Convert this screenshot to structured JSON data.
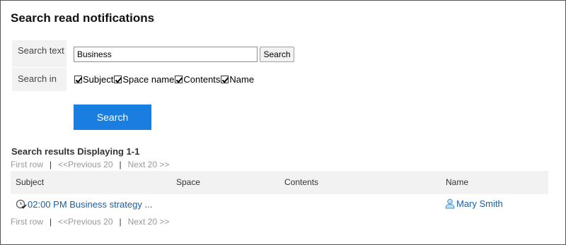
{
  "page": {
    "title": "Search read notifications"
  },
  "form": {
    "search_text_label": "Search text",
    "search_text_value": "Business",
    "small_search_button": "Search",
    "search_in_label": "Search in",
    "checkboxes": [
      {
        "label": "Subject",
        "checked": true
      },
      {
        "label": "Space name",
        "checked": true
      },
      {
        "label": "Contents",
        "checked": true
      },
      {
        "label": "Name",
        "checked": true
      }
    ],
    "search_button": "Search"
  },
  "results": {
    "heading": "Search results Displaying 1-1",
    "pager": {
      "first": "First row",
      "previous": "<<Previous 20",
      "next": "Next 20 >>",
      "separator": "|"
    },
    "columns": [
      "Subject",
      "Space",
      "Contents",
      "Name"
    ],
    "rows": [
      {
        "subject": "02:00 PM Business strategy ...",
        "space": "",
        "contents": "",
        "name": "Mary Smith"
      }
    ]
  },
  "colors": {
    "primary_button": "#1a7ee0",
    "link": "#1a5fa8",
    "header_bg": "#f2f2f2"
  },
  "icons": {
    "subject": "clock-check-icon",
    "name": "user-icon"
  }
}
